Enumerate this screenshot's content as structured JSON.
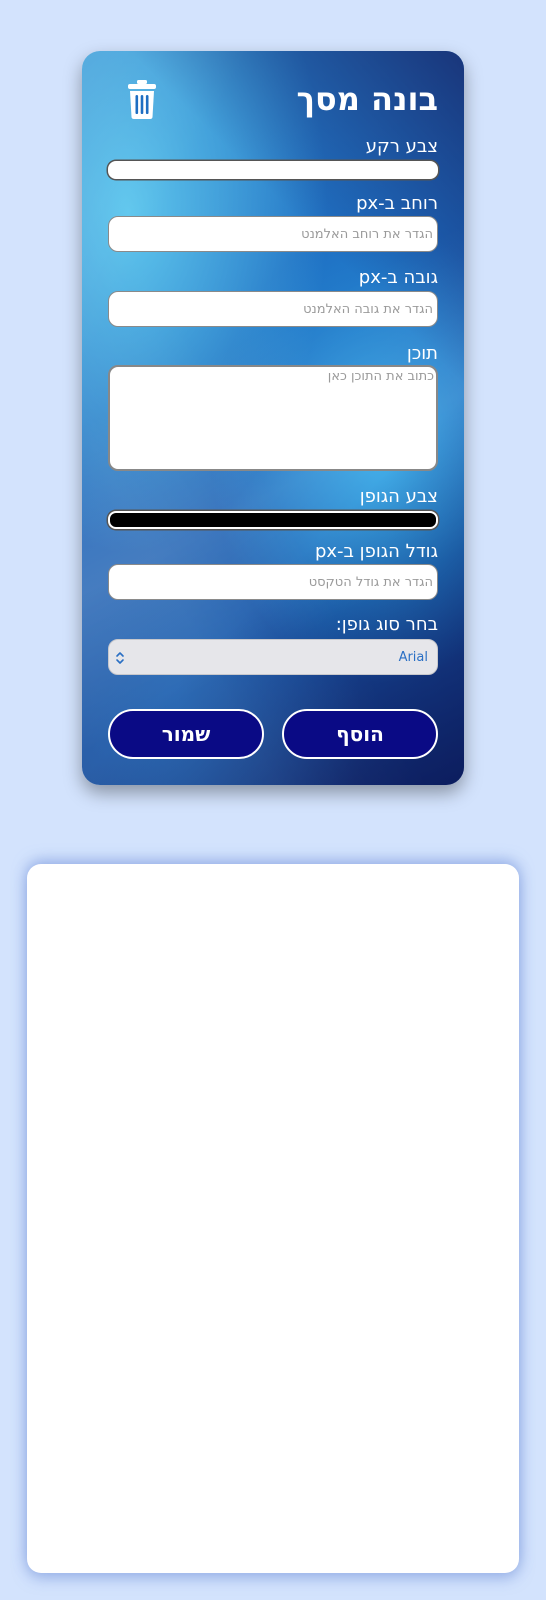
{
  "builder": {
    "title": "בונה מסך",
    "bg_color_label": "צבע רקע",
    "bg_color_value": "#ffffff",
    "width_label": "רוחב ב-px",
    "width_placeholder": "הגדר את רוחב האלמנט",
    "height_label": "גובה ב-px",
    "height_placeholder": "הגדר את גובה האלמנט",
    "content_label": "תוכן",
    "content_placeholder": "כתוב את התוכן כאן",
    "font_color_label": "צבע הגופן",
    "font_color_value": "#000000",
    "font_size_label": "גודל הגופן ב-px",
    "font_size_placeholder": "הגדר את גודל הטקסט",
    "font_family_label": "בחר סוג גופן:",
    "font_family_value": "Arial",
    "add_button": "הוסף",
    "save_button": "שמור"
  },
  "icons": {
    "delete": "trash-icon"
  },
  "colors": {
    "page_background": "#d3e3fd",
    "button_background": "#0a0a85",
    "select_text": "#2a6fc4"
  }
}
